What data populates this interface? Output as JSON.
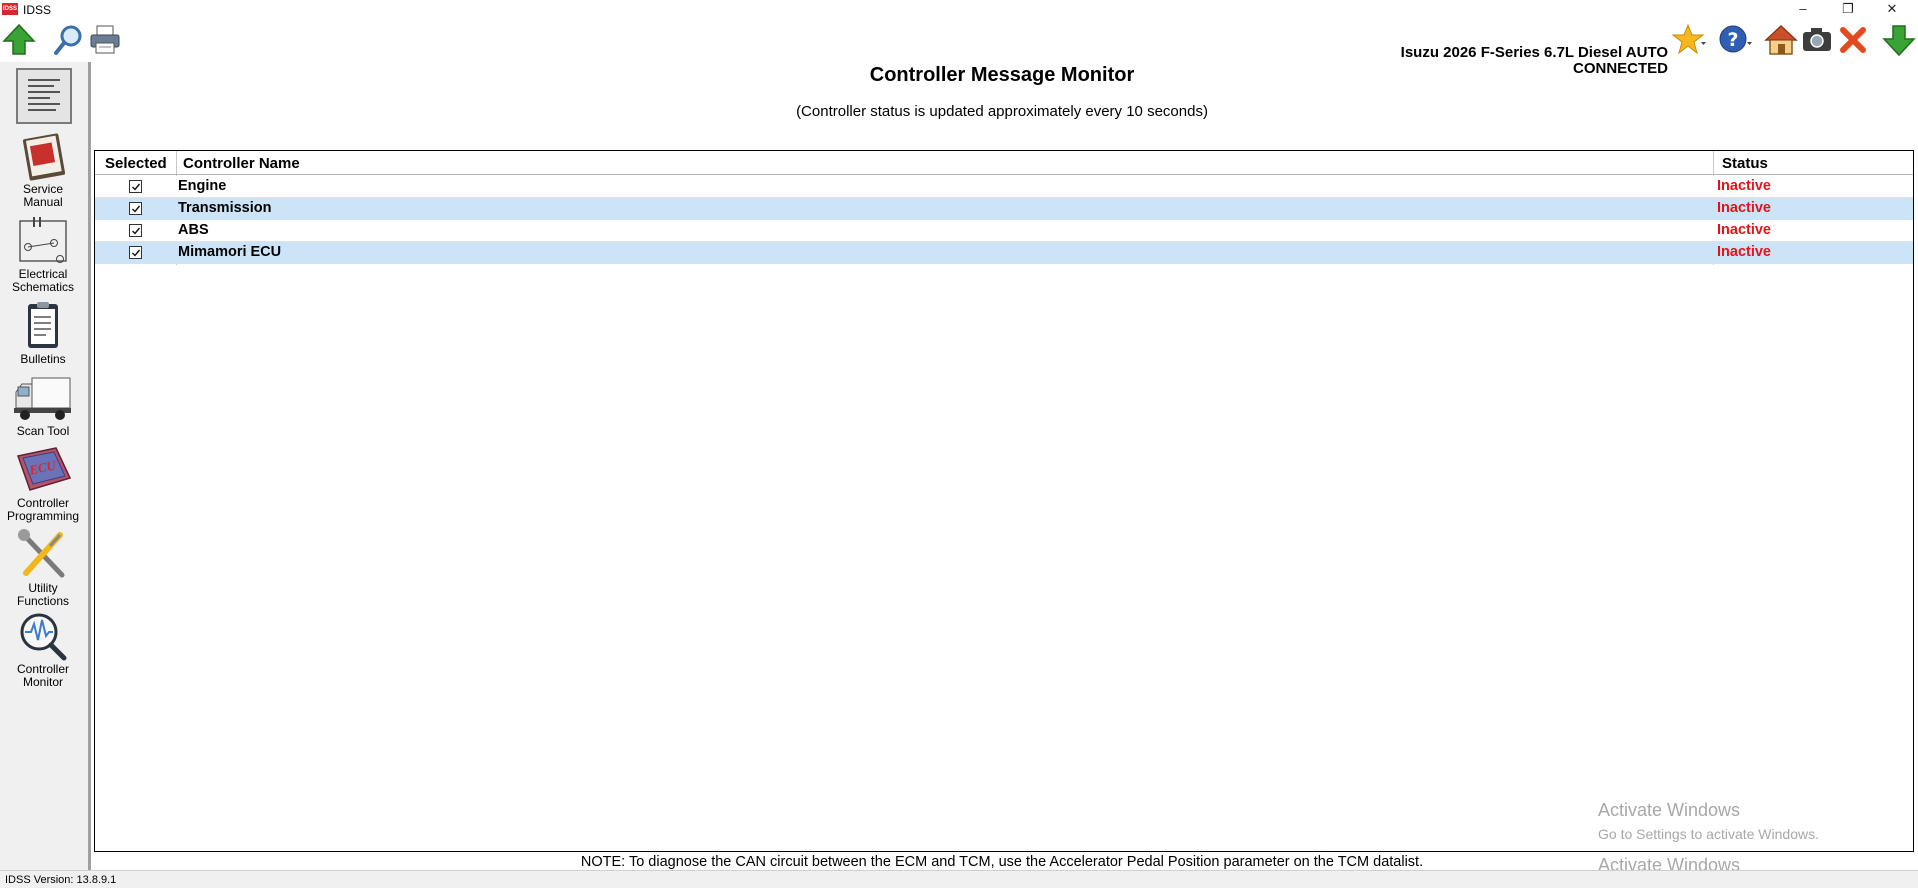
{
  "window": {
    "title": "IDSS",
    "logo_text": "IDSS",
    "controls": {
      "minimize": "–",
      "restore": "❐",
      "close": "✕"
    }
  },
  "toolbar": {
    "left_icons": [
      "upload-arrow-icon",
      "search-icon",
      "printer-icon"
    ],
    "vehicle_name": "Isuzu 2026 F-Series 6.7L Diesel AUTO",
    "connection_status": "CONNECTED",
    "right_icons": [
      "favorites-star-icon",
      "help-icon",
      "home-icon",
      "camera-icon",
      "close-session-icon",
      "download-arrow-icon"
    ]
  },
  "sidebar": {
    "items": [
      {
        "label": "Service\nManual",
        "icon": "service-manual-icon"
      },
      {
        "label": "Electrical\nSchematics",
        "icon": "electrical-schematics-icon"
      },
      {
        "label": "Bulletins",
        "icon": "bulletins-icon"
      },
      {
        "label": "Scan Tool",
        "icon": "scan-tool-truck-icon"
      },
      {
        "label": "Controller\nProgramming",
        "icon": "ecu-programming-icon",
        "icon_text": "ECU"
      },
      {
        "label": "Utility\nFunctions",
        "icon": "utility-tools-icon"
      },
      {
        "label": "Controller\nMonitor",
        "icon": "controller-monitor-icon"
      }
    ]
  },
  "main": {
    "title": "Controller Message Monitor",
    "subtitle": "(Controller status is updated approximately every 10 seconds)",
    "columns": {
      "selected": "Selected",
      "name": "Controller Name",
      "status": "Status"
    },
    "rows": [
      {
        "selected": true,
        "name": "Engine",
        "status": "Inactive"
      },
      {
        "selected": true,
        "name": "Transmission",
        "status": "Inactive"
      },
      {
        "selected": true,
        "name": "ABS",
        "status": "Inactive"
      },
      {
        "selected": true,
        "name": "Mimamori ECU",
        "status": "Inactive"
      }
    ],
    "note": "NOTE:  To diagnose the CAN circuit between the ECM and TCM, use the Accelerator Pedal Position parameter on the TCM datalist."
  },
  "watermark": {
    "title": "Activate Windows",
    "subtitle": "Go to Settings to activate Windows.",
    "title_repeat": "Activate Windows"
  },
  "status_bar": {
    "version": "IDSS Version: 13.8.9.1"
  },
  "colors": {
    "status_inactive": "#e0151c",
    "row_highlight": "#cce4f7",
    "accent_green": "#3aa335",
    "accent_red": "#d9262c"
  }
}
